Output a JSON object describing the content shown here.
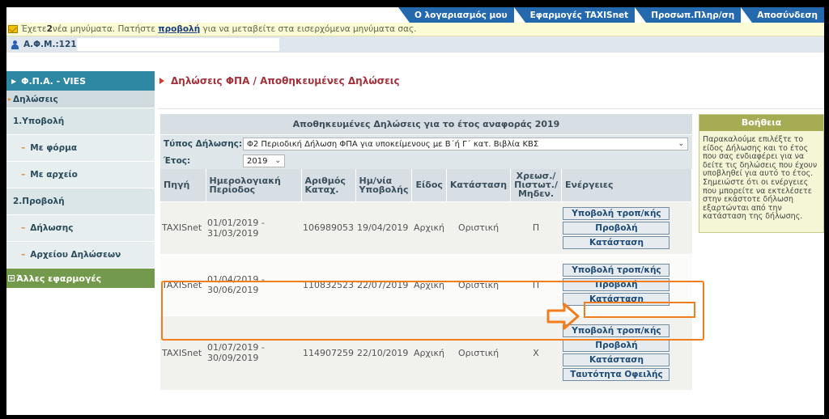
{
  "topnav": {
    "items": [
      {
        "label": "Ο λογαριασμός μου"
      },
      {
        "label": "Εφαρμογές TAXISnet"
      },
      {
        "label": "Προσωπ.Πληρ/ση"
      },
      {
        "label": "Αποσύνδεση"
      }
    ]
  },
  "message": {
    "prefix": "Έχετε ",
    "count": "2",
    "middle": " νέα μηνύματα. Πατήστε ",
    "link": "προβολή",
    "suffix": " για να μεταβείτε στα εισερχόμενα μηνύματα σας."
  },
  "afm": {
    "label": "Α.Φ.Μ.:121"
  },
  "sidebar": {
    "section": "Φ.Π.Α. - VIES",
    "items": [
      {
        "label": "Δηλώσεις"
      },
      {
        "label": "1.Υποβολή"
      },
      {
        "label": "Με φόρμα"
      },
      {
        "label": "Με αρχείο"
      },
      {
        "label": "2.Προβολή"
      },
      {
        "label": "Δήλωσης"
      },
      {
        "label": "Αρχείου Δηλώσεων"
      }
    ],
    "other": "Άλλες εφαρμογές"
  },
  "breadcrumb": "Δηλώσεις ΦΠΑ / Αποθηκευμένες Δηλώσεις",
  "panel": {
    "title": "Αποθηκευμένες Δηλώσεις για το έτος αναφοράς 2019",
    "type_label": "Τύπος Δήλωσης:",
    "type_value": "Φ2 Περιοδική Δήλωση ΦΠΑ για υποκείμενους με Β΄ή Γ΄ κατ. Βιβλία ΚΒΣ",
    "year_label": "Έτος:",
    "year_value": "2019"
  },
  "table": {
    "headers": {
      "source": "Πηγή",
      "period": "Ημερολογιακή Περίοδος",
      "regno": "Αριθμός Καταχ.",
      "date": "Ημ/νία Υποβολής",
      "kind": "Είδος",
      "status": "Κατάσταση",
      "debit": "Χρεωσ./ Πιστωτ./ Μηδεν.",
      "actions": "Ενέργειες"
    },
    "rows": [
      {
        "source": "TAXISnet",
        "period": "01/01/2019 - 31/03/2019",
        "regno": "106989053",
        "date": "19/04/2019",
        "kind": "Αρχική",
        "status": "Οριστική",
        "debit": "Π",
        "actions": [
          "Υποβολή τροπ/κής",
          "Προβολή",
          "Κατάσταση"
        ]
      },
      {
        "source": "TAXISnet",
        "period": "01/04/2019 - 30/06/2019",
        "regno": "110832523",
        "date": "22/07/2019",
        "kind": "Αρχική",
        "status": "Οριστική",
        "debit": "Π",
        "actions": [
          "Υποβολή τροπ/κής",
          "Προβολή",
          "Κατάσταση"
        ]
      },
      {
        "source": "TAXISnet",
        "period": "01/07/2019 - 30/09/2019",
        "regno": "114907259",
        "date": "22/10/2019",
        "kind": "Αρχική",
        "status": "Οριστική",
        "debit": "Χ",
        "actions": [
          "Υποβολή τροπ/κής",
          "Προβολή",
          "Κατάσταση",
          "Ταυτότητα Οφειλής"
        ]
      }
    ]
  },
  "help": {
    "title": "Βοήθεια",
    "text": "Παρακαλούμε επιλέξτε το είδος Δήλωσης και το έτος που σας ενδιαφέρει για να δείτε τις δηλώσεις που έχουν υποβληθεί για αυτό το έτος. Σημειώστε ότι οι ενέργειες που μπορείτε να εκτελέσετε στην εκάστοτε δήλωση εξαρτώνται από την κατάσταση της δήλωσης."
  },
  "colors": {
    "highlight": "#f27d1e",
    "nav": "#2468ad",
    "sidebar_accent": "#2e88a3",
    "other_apps": "#739a4c"
  }
}
